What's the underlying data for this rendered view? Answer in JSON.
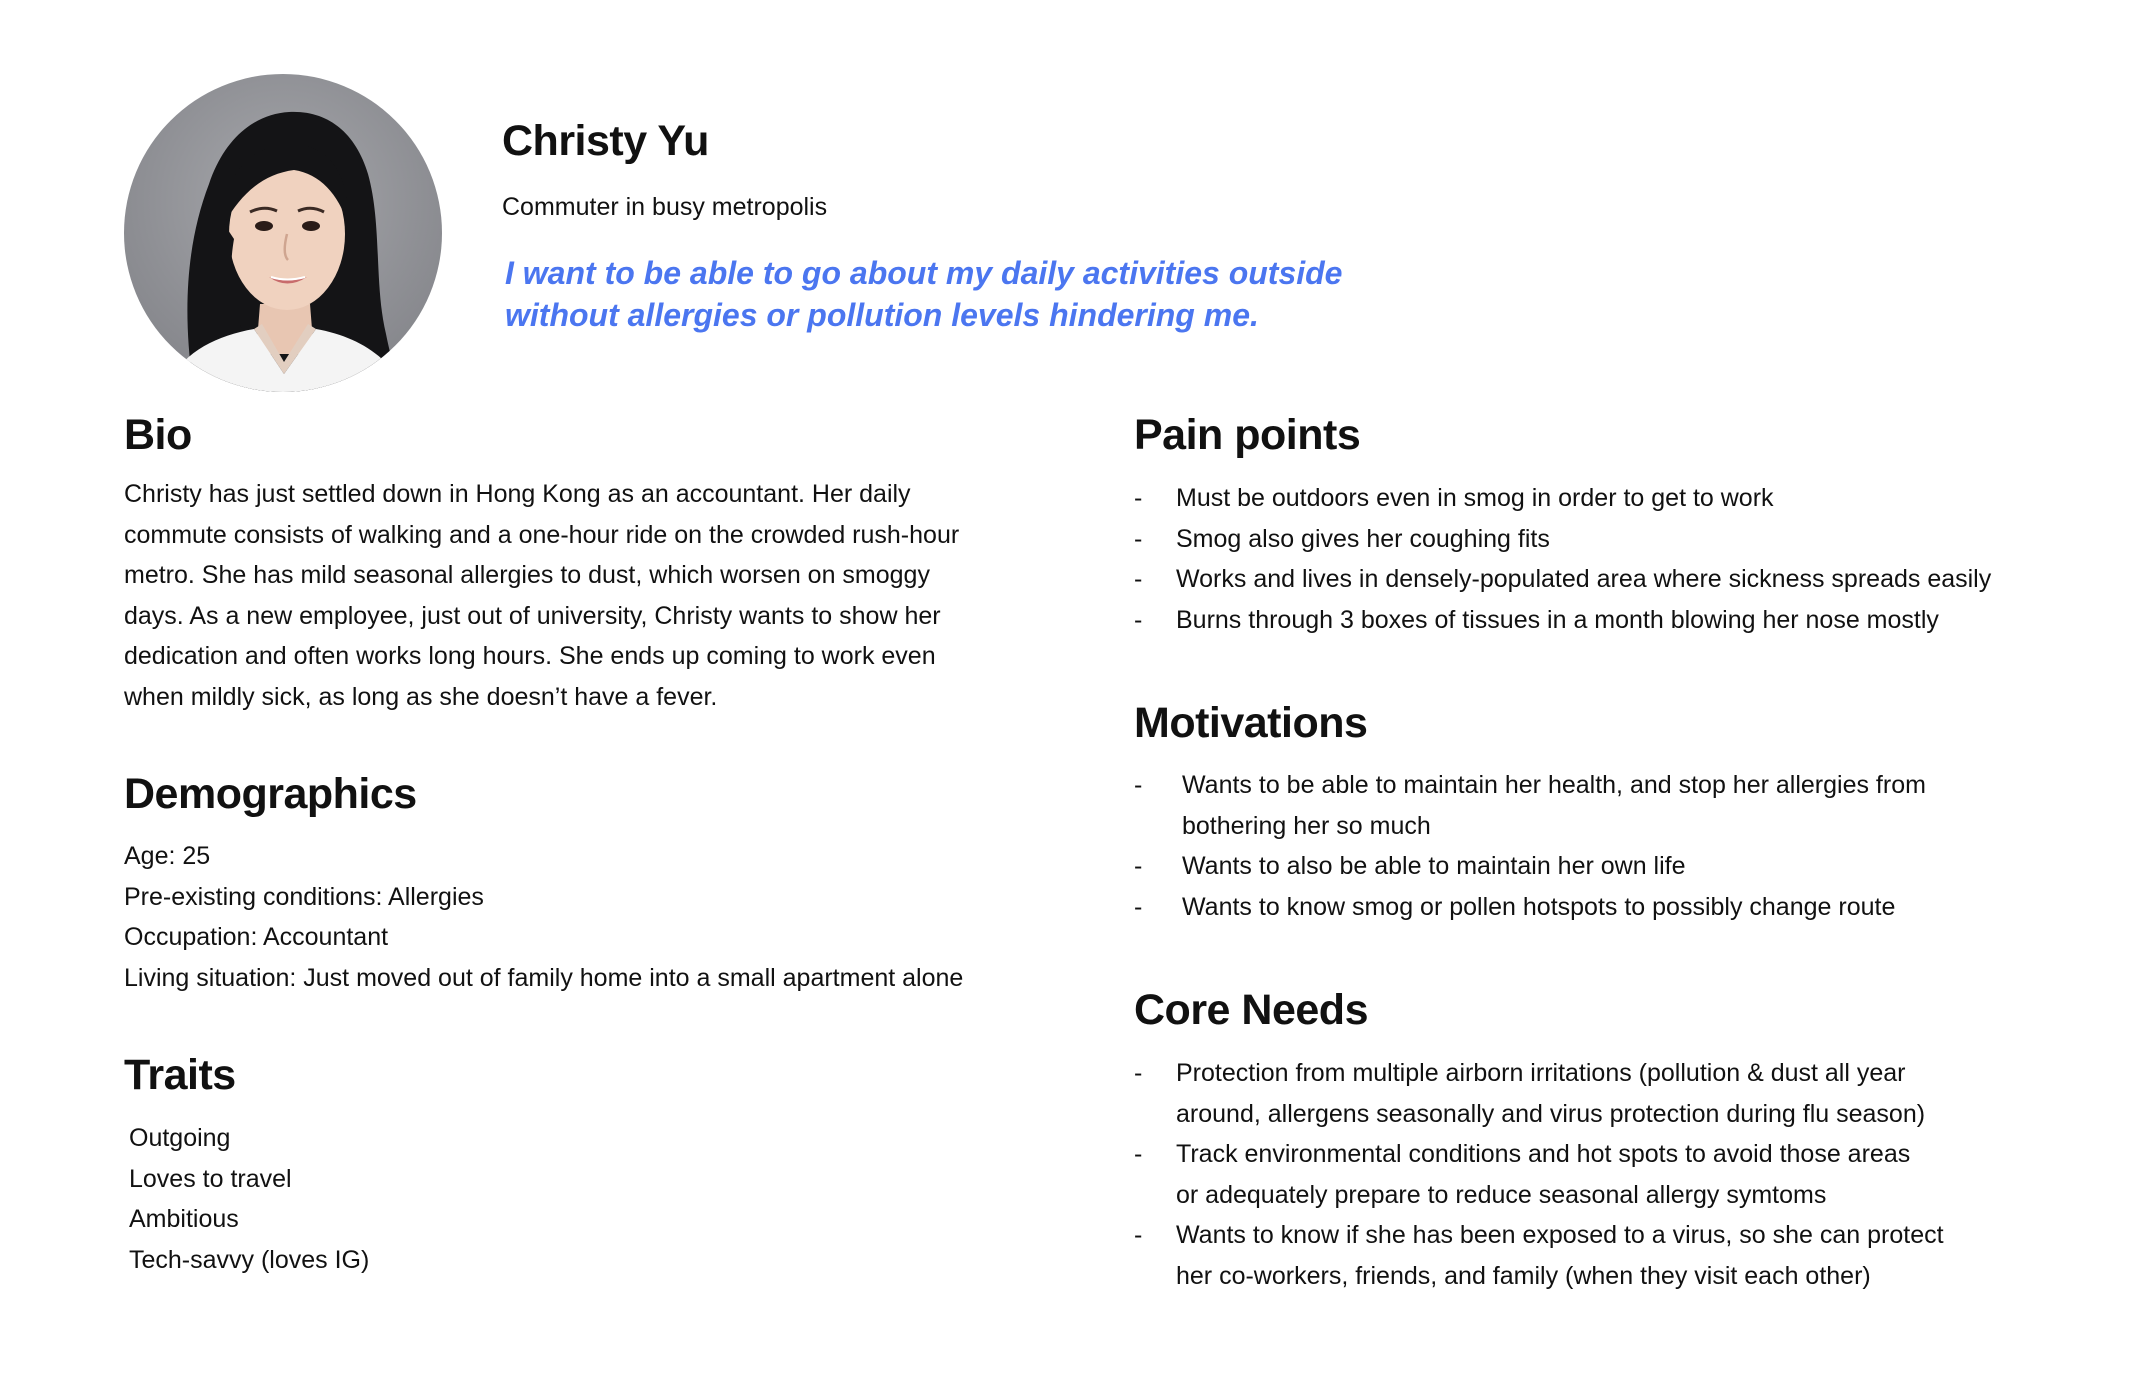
{
  "persona": {
    "name": "Christy Yu",
    "role": "Commuter in busy metropolis",
    "quote_lines": [
      "I want to be able to go about my daily activities outside",
      "without allergies or pollution levels hindering me."
    ],
    "accent_color": "#4b76f0"
  },
  "bio": {
    "title": "Bio",
    "lines": [
      "Christy has just settled down in Hong Kong as an accountant. Her daily",
      "commute consists of walking and a one-hour ride on the crowded rush-hour",
      "metro. She has mild seasonal allergies to dust, which worsen on smoggy",
      "days. As a new employee, just out of university, Christy wants to show her",
      "dedication and often works long hours. She ends up coming to work even",
      "when mildly sick, as long as she doesn’t have a fever."
    ]
  },
  "demographics": {
    "title": "Demographics",
    "lines": [
      "Age: 25",
      "Pre-existing conditions: Allergies",
      "Occupation: Accountant",
      "Living situation: Just moved out of family home into a small apartment alone"
    ]
  },
  "traits": {
    "title": "Traits",
    "items": [
      "Outgoing",
      "Loves to travel",
      "Ambitious",
      "Tech-savvy (loves IG)"
    ]
  },
  "pain_points": {
    "title": "Pain points",
    "marker": "-",
    "items": [
      [
        "Must be outdoors even in smog in order to get to work"
      ],
      [
        "Smog also gives her coughing fits"
      ],
      [
        "Works and lives in densely-populated area where sickness spreads easily"
      ],
      [
        "Burns through 3 boxes of tissues in a month blowing her nose mostly"
      ]
    ]
  },
  "motivations": {
    "title": "Motivations",
    "marker": "-",
    "items": [
      [
        "Wants to be able to maintain her health, and stop her allergies from",
        "bothering her so much"
      ],
      [
        "Wants to also be able to maintain her own life"
      ],
      [
        "Wants to know smog or pollen hotspots to possibly change route"
      ]
    ]
  },
  "core_needs": {
    "title": "Core Needs",
    "marker": "-",
    "items": [
      [
        "Protection from multiple airborn irritations (pollution & dust all year",
        "around, allergens seasonally and virus protection during flu season)"
      ],
      [
        "Track environmental conditions and hot spots to avoid those areas",
        "or adequately prepare to reduce seasonal allergy symtoms"
      ],
      [
        "Wants to know if she has been exposed to a virus, so she can protect",
        "her co-workers, friends, and family (when they visit each other)"
      ]
    ]
  }
}
